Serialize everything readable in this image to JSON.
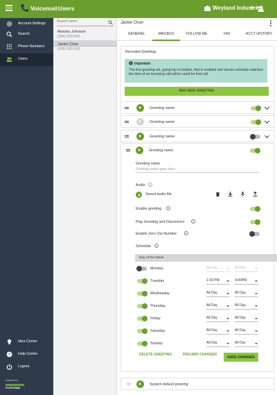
{
  "app": {
    "title": "Voicemail",
    "section": "Users",
    "account": "Weyland Industries"
  },
  "sidebar": {
    "items": [
      {
        "label": "Account Settings"
      },
      {
        "label": "Search"
      },
      {
        "label": "Phone Numbers"
      },
      {
        "label": "Users"
      }
    ],
    "bottom": [
      {
        "label": "Idea Center"
      },
      {
        "label": "Help Center"
      },
      {
        "label": "Logout"
      }
    ],
    "powered_by": "powered by",
    "platform": "PLATFORM28"
  },
  "userlist": {
    "search_placeholder": "Search users",
    "users": [
      {
        "name": "Marsha Johnson",
        "phone": "(555) 555-555"
      },
      {
        "name": "Jackie Chan",
        "phone": "(555) 555-555"
      }
    ]
  },
  "main": {
    "title": "Jackie Chan",
    "tabs": [
      "GENERAL",
      "MAILBOX",
      "FOLLOW ME",
      "FAX",
      "ACCT HISTORY"
    ],
    "active_tab": "MAILBOX",
    "card_title": "Recorded Greetings",
    "important_title": "Important",
    "important_body": "The first greeting set, going top to bottom, that is enabled and whose schedule matches the time of an incoming call will be used for that call.",
    "add_button": "ADD NEW GREETING",
    "greetings": [
      {
        "name": "Greeting name",
        "enabled": true,
        "playable": true
      },
      {
        "name": "Greeting name",
        "enabled": true,
        "playable": false
      },
      {
        "name": "Greeting name",
        "enabled": false,
        "playable": true
      },
      {
        "name": "Greeting name",
        "enabled": true,
        "playable": true
      }
    ],
    "form": {
      "name_label": "Greeting name",
      "name_placeholder": "Greeting name goes here",
      "audio_label": "Audio",
      "audio_file": "Saved audio file",
      "enable_label": "Enable greeting",
      "play_disconnect_label": "Play Greeting and Disconnect",
      "zero_out_label": "Enable Zero Out Number",
      "schedule_label": "Schedule",
      "schedule_header": "Day of the Week",
      "toggles": {
        "enable": true,
        "play_disconnect": true,
        "zero_out": false
      }
    },
    "schedule": [
      {
        "day": "Monday",
        "enabled": false,
        "start": "All Day",
        "end": "All Day"
      },
      {
        "day": "Tuesday",
        "enabled": true,
        "start": "1:30 PM",
        "end": "4:00PM"
      },
      {
        "day": "Wednesday",
        "enabled": true,
        "start": "All Day",
        "end": "All Day"
      },
      {
        "day": "Thursday",
        "enabled": true,
        "start": "All Day",
        "end": "All Day"
      },
      {
        "day": "Firday",
        "enabled": true,
        "start": "All Day",
        "end": "All Day"
      },
      {
        "day": "Saturday",
        "enabled": true,
        "start": "All Day",
        "end": "All Day"
      },
      {
        "day": "Sunday",
        "enabled": true,
        "start": "All Day",
        "end": "All Day"
      }
    ],
    "actions": {
      "delete": "DELETE GREETING",
      "discard": "DISCARD CHANGES",
      "save": "SAVE CHANGES"
    },
    "system_greeting": "System default greeting"
  },
  "colors": {
    "brand_green": "#6a9e2d",
    "sidebar_bg": "#2f3b4a",
    "important_bg": "#aedccf",
    "button_green": "#8dc63f"
  }
}
